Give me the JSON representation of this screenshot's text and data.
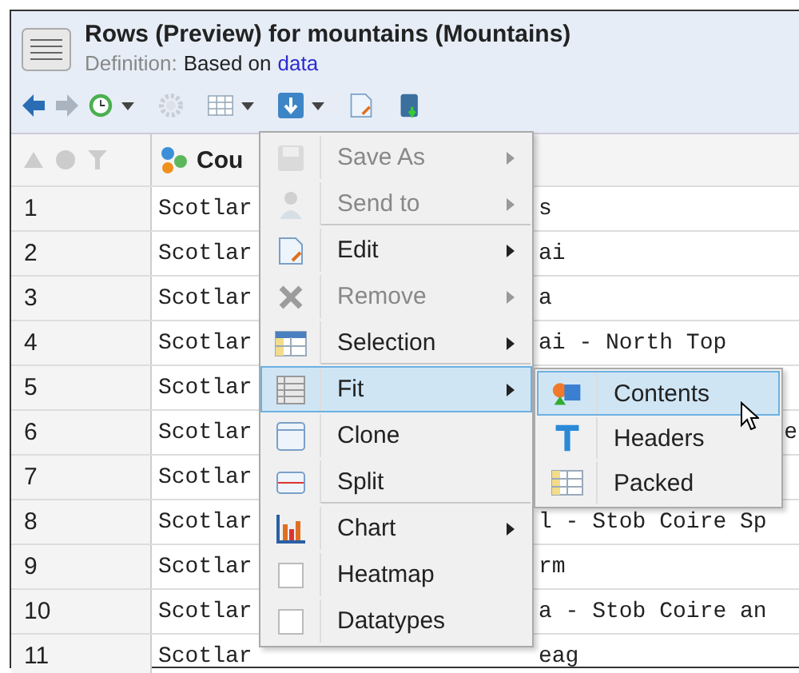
{
  "window": {
    "title": "Rows (Preview) for mountains (Mountains)",
    "definition_label": "Definition:",
    "definition_text": "Based on",
    "definition_link": "data"
  },
  "table": {
    "column_2_header": "Cou",
    "rows": [
      {
        "index": "1",
        "column_2": "Scotlar",
        "tail": "s",
        "kind": "plain"
      },
      {
        "index": "2",
        "column_2": "Scotlar",
        "tail": "ai",
        "kind": "plain"
      },
      {
        "index": "3",
        "column_2": "Scotlar",
        "tail": "a",
        "kind": "plain"
      },
      {
        "index": "4",
        "column_2": "Scotlar",
        "tail": "ai - North Top",
        "kind": "plain"
      },
      {
        "index": "5",
        "column_2": "Scotlar",
        "kind": "plain"
      },
      {
        "index": "6",
        "column_2": "Scotlar",
        "tail": "e",
        "kind": "edge"
      },
      {
        "index": "7",
        "column_2": "Scotlar",
        "kind": "plain"
      },
      {
        "index": "8",
        "column_2": "Scotlar",
        "tail": "l - Stob Coire Sp",
        "kind": "plain"
      },
      {
        "index": "9",
        "column_2": "Scotlar",
        "tail": "rm",
        "kind": "plain"
      },
      {
        "index": "10",
        "column_2": "Scotlar",
        "tail": "a - Stob Coire an",
        "kind": "plain"
      },
      {
        "index": "11",
        "column_2": "Scotlar",
        "tail": "eag",
        "kind": "plain"
      }
    ]
  },
  "context_menu": {
    "items": [
      {
        "label": "Save As",
        "kind": "floppy",
        "disabled": true,
        "submenu": true,
        "selected": false,
        "separator_after": false
      },
      {
        "label": "Send to",
        "kind": "person",
        "disabled": true,
        "submenu": true,
        "selected": false,
        "separator_after": true
      },
      {
        "label": "Edit",
        "kind": "page",
        "disabled": false,
        "submenu": true,
        "selected": false,
        "separator_after": false
      },
      {
        "label": "Remove",
        "kind": "cross",
        "disabled": true,
        "submenu": true,
        "selected": false,
        "separator_after": false
      },
      {
        "label": "Selection",
        "kind": "grid",
        "disabled": false,
        "submenu": true,
        "selected": false,
        "separator_after": true
      },
      {
        "label": "Fit",
        "kind": "rows",
        "disabled": false,
        "submenu": true,
        "selected": true,
        "separator_after": false
      },
      {
        "label": "Clone",
        "kind": "window",
        "disabled": false,
        "submenu": false,
        "selected": false,
        "separator_after": false
      },
      {
        "label": "Split",
        "kind": "split",
        "disabled": false,
        "submenu": false,
        "selected": false,
        "separator_after": true
      },
      {
        "label": "Chart",
        "kind": "chart",
        "disabled": false,
        "submenu": true,
        "selected": false,
        "separator_after": false
      },
      {
        "label": "Heatmap",
        "kind": "check",
        "checked": false,
        "disabled": false,
        "submenu": false,
        "selected": false,
        "separator_after": false
      },
      {
        "label": "Datatypes",
        "kind": "check",
        "checked": false,
        "disabled": false,
        "submenu": false,
        "selected": false,
        "separator_after": false
      }
    ]
  },
  "submenu": {
    "items": [
      {
        "label": "Contents",
        "kind": "shapes",
        "selected": true
      },
      {
        "label": "Headers",
        "kind": "letter",
        "selected": false
      },
      {
        "label": "Packed",
        "kind": "grid",
        "selected": false
      }
    ]
  }
}
